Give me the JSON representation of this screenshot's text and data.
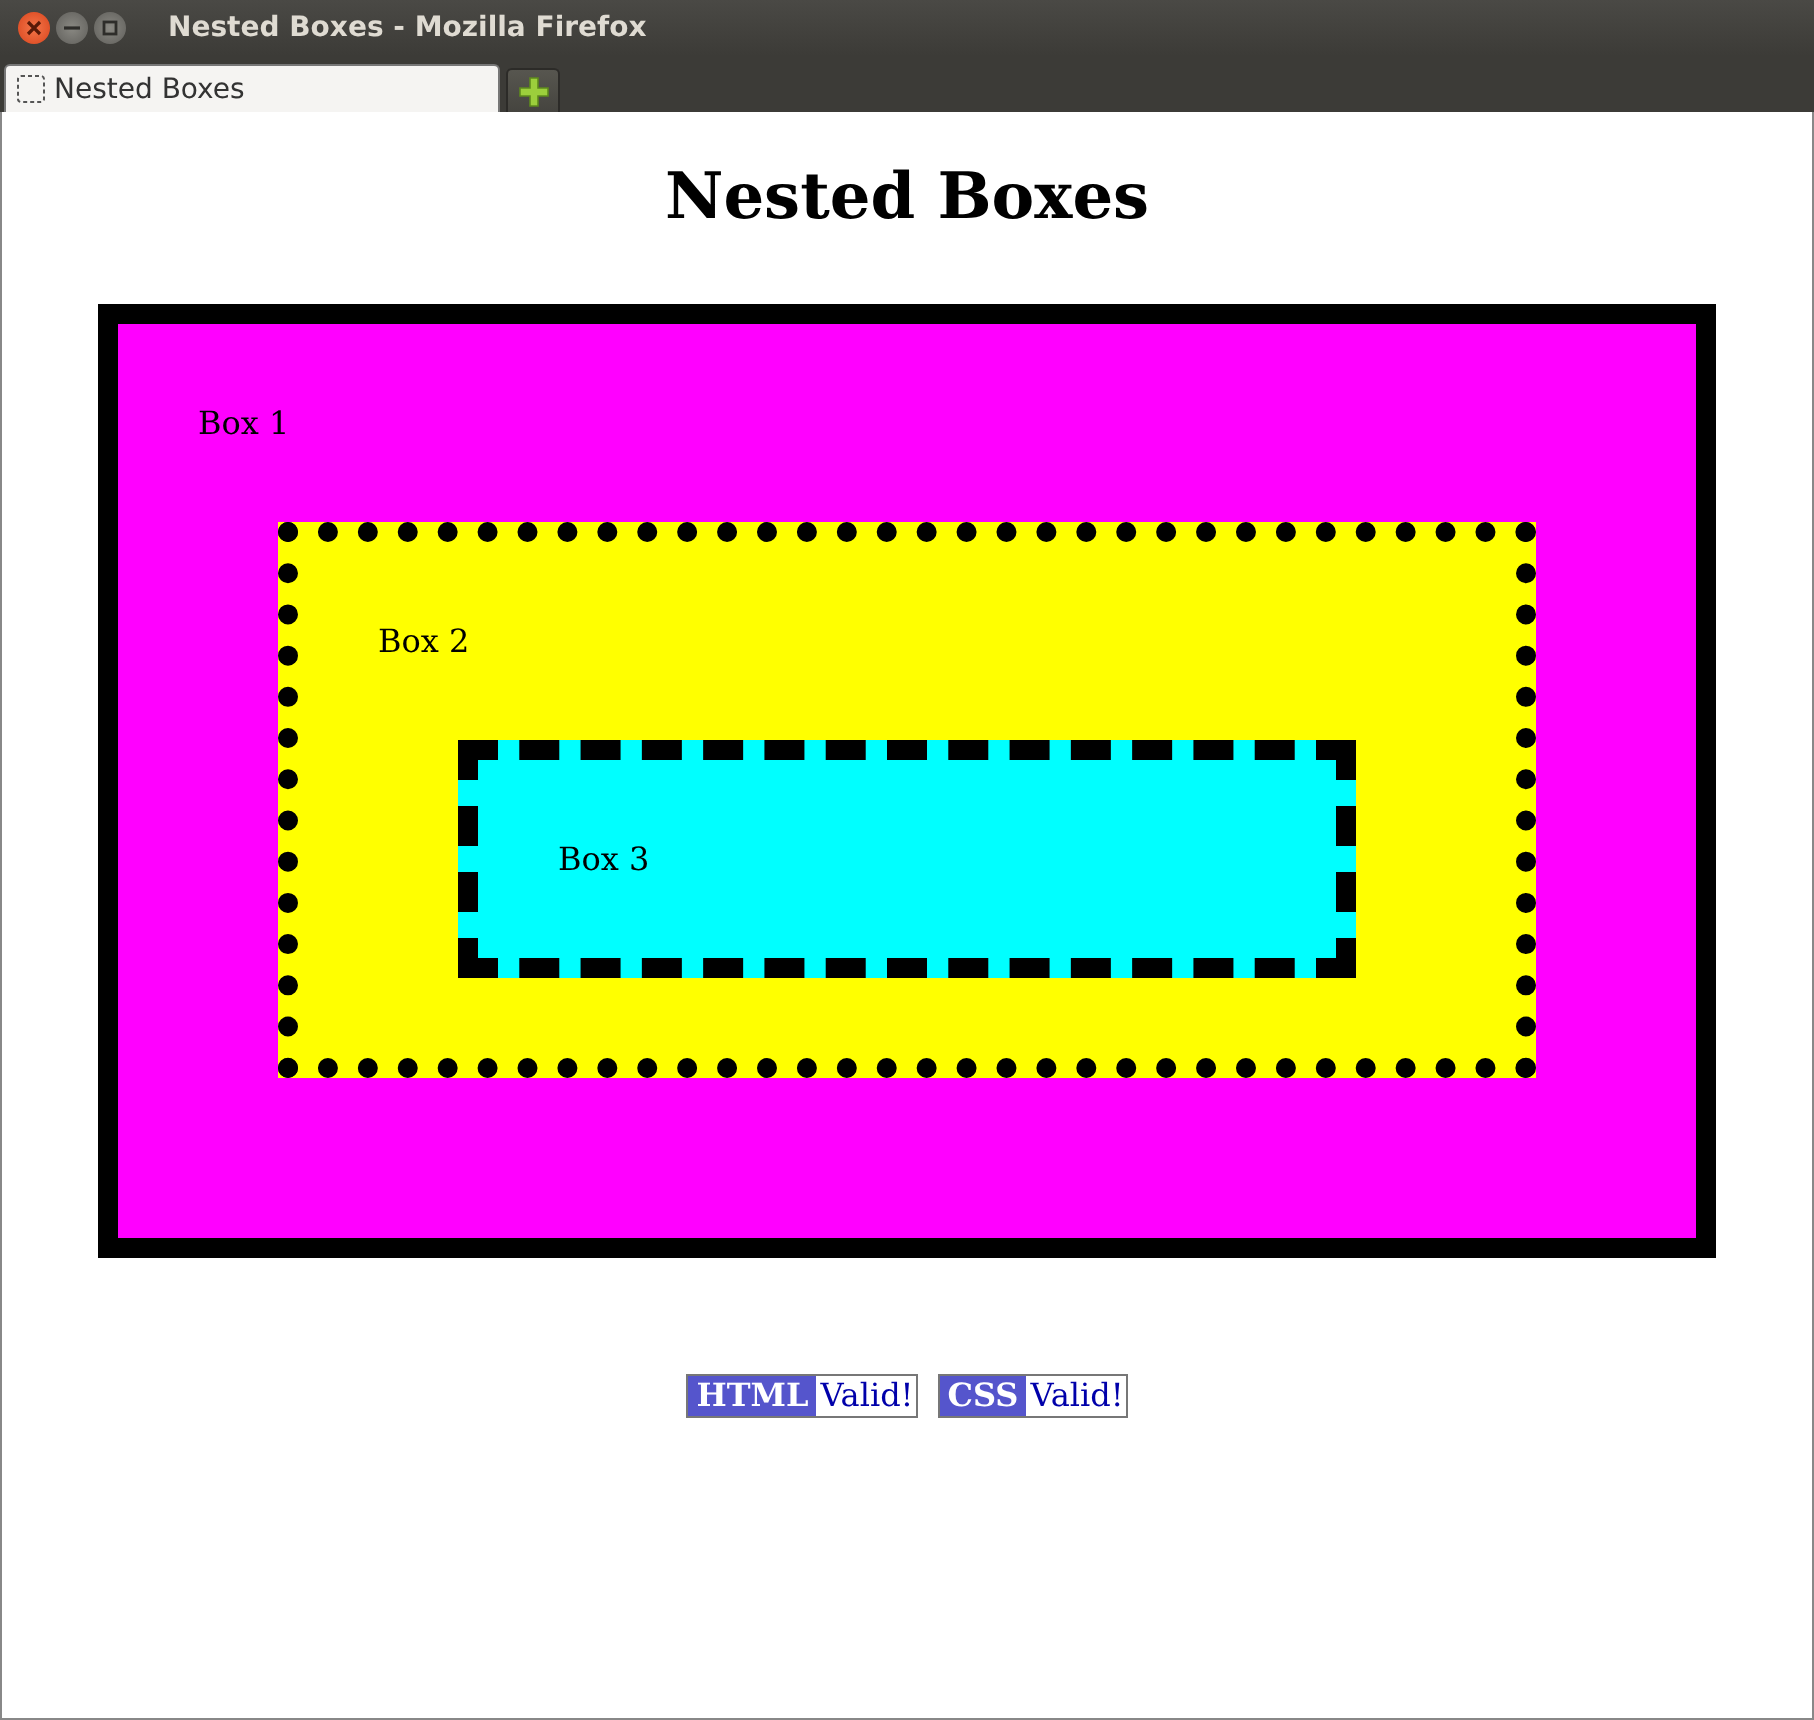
{
  "window": {
    "title": "Nested Boxes - Mozilla Firefox"
  },
  "tabs": [
    {
      "label": "Nested Boxes",
      "selected": true
    }
  ],
  "heading": "Nested Boxes",
  "boxes": [
    {
      "label": "Box 1",
      "kind": "solid",
      "color": "#ff00ff",
      "children": [
        {
          "label": "Box 2",
          "kind": "dotted",
          "color": "#ffff00",
          "children": [
            {
              "label": "Box 3",
              "kind": "dashed",
              "color": "#00ffff"
            }
          ]
        }
      ]
    }
  ],
  "badges": [
    {
      "name": "HTML",
      "status": "Valid!"
    },
    {
      "name": "CSS",
      "status": "Valid!"
    }
  ]
}
